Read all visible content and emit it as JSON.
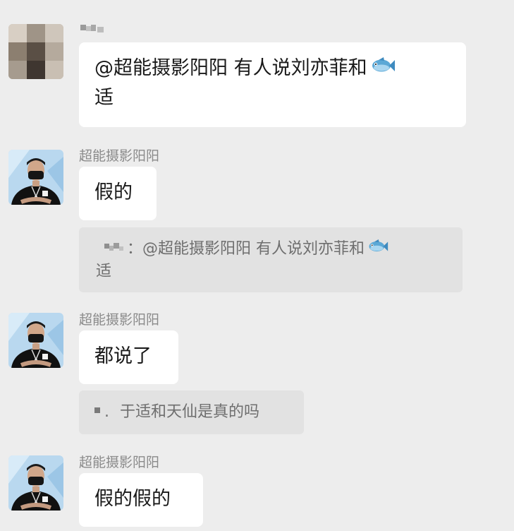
{
  "messages": [
    {
      "id": "m1",
      "sender": "",
      "text_line1": "@超能摄影阳阳 有人说刘亦菲和",
      "emoji": "fish-emoji",
      "text_line2": "适"
    },
    {
      "id": "m2",
      "sender": "超能摄影阳阳",
      "text": "假的",
      "quote": {
        "separator": "：",
        "line1": "@超能摄影阳阳 有人说刘亦菲和",
        "emoji": "fish-emoji",
        "line2": "适"
      }
    },
    {
      "id": "m3",
      "sender": "超能摄影阳阳",
      "text": "都说了",
      "quote": {
        "separator": ".",
        "line1": "于适和天仙是真的吗"
      }
    },
    {
      "id": "m4",
      "sender": "超能摄影阳阳",
      "text": "假的假的"
    }
  ],
  "colors": {
    "background": "#ededed",
    "bubble": "#ffffff",
    "quote_bg": "#e2e2e2",
    "sender_text": "#8a8a8a"
  }
}
